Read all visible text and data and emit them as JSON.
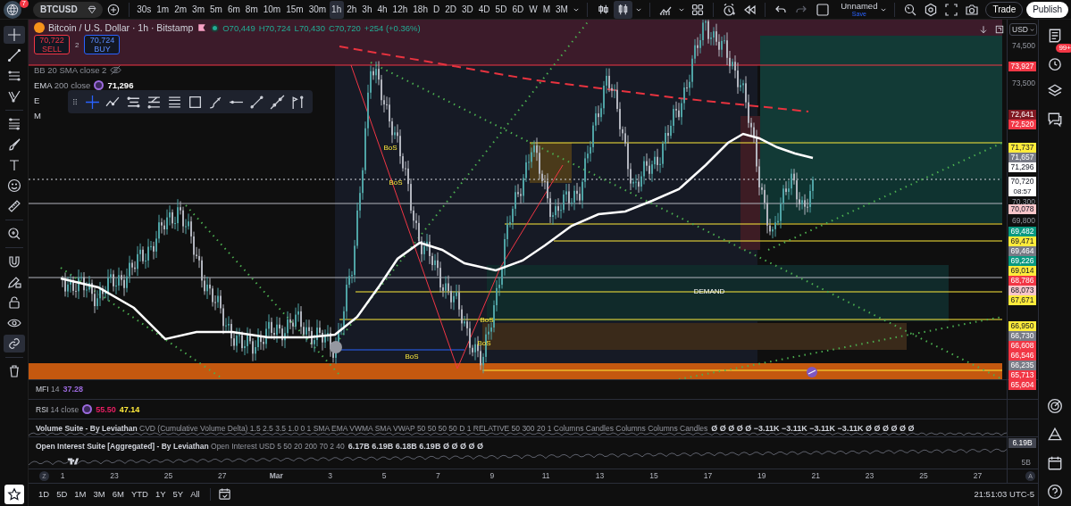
{
  "toolbar": {
    "logo_badge": "7",
    "symbol": "BTCUSD",
    "intervals": [
      {
        "label": "30s",
        "selected": false
      },
      {
        "label": "1m",
        "selected": false
      },
      {
        "label": "2m",
        "selected": false
      },
      {
        "label": "3m",
        "selected": false
      },
      {
        "label": "5m",
        "selected": false
      },
      {
        "label": "6m",
        "selected": false
      },
      {
        "label": "8m",
        "selected": false
      },
      {
        "label": "10m",
        "selected": false
      },
      {
        "label": "15m",
        "selected": false
      },
      {
        "label": "30m",
        "selected": false
      },
      {
        "label": "1h",
        "selected": true
      },
      {
        "label": "2h",
        "selected": false
      },
      {
        "label": "3h",
        "selected": false
      },
      {
        "label": "4h",
        "selected": false
      },
      {
        "label": "12h",
        "selected": false
      },
      {
        "label": "18h",
        "selected": false
      },
      {
        "label": "D",
        "selected": false
      },
      {
        "label": "2D",
        "selected": false
      },
      {
        "label": "3D",
        "selected": false
      },
      {
        "label": "4D",
        "selected": false
      },
      {
        "label": "5D",
        "selected": false
      },
      {
        "label": "6D",
        "selected": false
      },
      {
        "label": "W",
        "selected": false
      },
      {
        "label": "M",
        "selected": false
      },
      {
        "label": "3M",
        "selected": false
      }
    ],
    "chart_types": [
      {
        "selected": false
      },
      {
        "selected": true
      }
    ],
    "layout_name": "Unnamed",
    "save_label": "Save",
    "buttons": [
      {
        "label": "Trade",
        "kind": "outline"
      },
      {
        "label": "Publish",
        "kind": "filled"
      }
    ]
  },
  "tools": [
    {
      "selected": true
    },
    {
      "selected": false
    },
    {
      "selected": false
    },
    {
      "selected": false
    },
    {
      "selected": false
    },
    {
      "selected": false
    },
    {
      "selected": false
    },
    {
      "selected": false
    },
    {
      "selected": false
    },
    {
      "selected": false
    },
    {
      "selected": false
    },
    {
      "selected": false
    },
    {
      "selected": false
    },
    {
      "selected": false
    },
    {
      "selected": true
    },
    {
      "selected": false
    }
  ],
  "legend": {
    "title": "Bitcoin / U.S. Dollar · 1h · Bitstamp",
    "ohlc": [
      "O70,449",
      "H70,724",
      "L70,430",
      "C70,720"
    ],
    "change": "+254 (+0.36%)",
    "sell": {
      "price": "70,722",
      "label": "SELL"
    },
    "spread": "2",
    "buy": {
      "price": "70,724",
      "label": "BUY"
    },
    "indicators": [
      {
        "name": "BB",
        "params": "20 SMA close 2",
        "hidden": true
      },
      {
        "name": "EMA",
        "params": "200 close",
        "value": "71,296",
        "hidden": false
      },
      {
        "name": "E",
        "hidden": false
      },
      {
        "name": "M",
        "hidden": false
      }
    ]
  },
  "annotations": [
    {
      "text": "BoS"
    },
    {
      "text": "BoS"
    },
    {
      "text": "BoS"
    },
    {
      "text": "BoS"
    },
    {
      "text": "BoS"
    },
    {
      "text": "DEMAND"
    }
  ],
  "price_scale": {
    "currency": "USD",
    "ticks": [
      "74,500",
      "73,500",
      "70,300",
      "69,800"
    ],
    "tags": [
      {
        "text": "73,927",
        "color": "#f23645"
      },
      {
        "text": "72,641",
        "color": "#801922"
      },
      {
        "text": "72,520",
        "color": "#f23645"
      },
      {
        "text": "71,737",
        "color": "#ffeb3b"
      },
      {
        "text": "71,657",
        "color": "#787b86"
      },
      {
        "text": "71,296",
        "color": "#ffffff"
      },
      {
        "text": "70,720",
        "countdown": "08:57",
        "color": "#ffffff"
      },
      {
        "text": "70,078",
        "color": "#f8c5c9"
      },
      {
        "text": "69,482",
        "color": "#089981"
      },
      {
        "text": "69,471",
        "color": "#ffeb3b"
      },
      {
        "text": "69,464",
        "color": "#787b86"
      },
      {
        "text": "69,226",
        "color": "#089981"
      },
      {
        "text": "69,014",
        "color": "#ffeb3b"
      },
      {
        "text": "68,786",
        "color": "#f23645"
      },
      {
        "text": "68,073",
        "color": "#f8c5c9"
      },
      {
        "text": "67,671",
        "color": "#ffeb3b"
      },
      {
        "text": "66,950",
        "color": "#ffeb3b"
      },
      {
        "text": "66,730",
        "color": "#787b86"
      },
      {
        "text": "66,608",
        "color": "#f23645"
      },
      {
        "text": "66,546",
        "color": "#f23645"
      },
      {
        "text": "66,235",
        "color": "#787b86"
      },
      {
        "text": "65,713",
        "color": "#f23645"
      },
      {
        "text": "65,604",
        "color": "#f23645"
      }
    ]
  },
  "panes": [
    {
      "title": "MFI",
      "params": "14",
      "values": [
        {
          "text": "37.28",
          "color": "#9c6ade"
        }
      ]
    },
    {
      "title": "RSI",
      "params": "14 close",
      "values": [
        {
          "text": "55.50",
          "color": "#e91e63"
        },
        {
          "text": "47.14",
          "color": "#ffeb3b"
        }
      ]
    },
    {
      "title": "Volume Suite - By Leviathan",
      "params": "CVD (Cumulative Volume Delta) 1.5 2.5 3.5 1.0 0 1 SMA EMA VWMA SMA VWAP 50 50 50 50 D 1 RELATIVE 50 300 20 1 Columns Candles Columns Columns Candles",
      "values": [
        {
          "text": "Ø Ø Ø Ø Ø −3.11K −3.11K −3.11K −3.11K Ø Ø Ø Ø Ø Ø",
          "color": "#d1d4dc"
        }
      ]
    },
    {
      "title": "Open Interest Suite [Aggregated] - By Leviathan",
      "params": "Open Interest USD 5 50 20 200 70 2 40",
      "values": [
        {
          "text": "6.17B 6.19B 6.18B 6.19B Ø Ø Ø Ø Ø",
          "color": "#d1d4dc"
        }
      ],
      "axis_tag": "6.19B",
      "axis_tick": "5B"
    }
  ],
  "time_axis": {
    "left_button": "Z",
    "right_button": "A",
    "labels": [
      "1",
      "23",
      "25",
      "27",
      "Mar",
      "3",
      "5",
      "7",
      "9",
      "11",
      "13",
      "15",
      "17",
      "19",
      "21",
      "23",
      "25",
      "27"
    ]
  },
  "bottom_bar": {
    "ranges": [
      "1D",
      "5D",
      "1M",
      "3M",
      "6M",
      "YTD",
      "1Y",
      "5Y",
      "All"
    ],
    "time": "21:51:03 UTC-5"
  },
  "right_sidebar": {
    "alerts_badge": "99+"
  }
}
